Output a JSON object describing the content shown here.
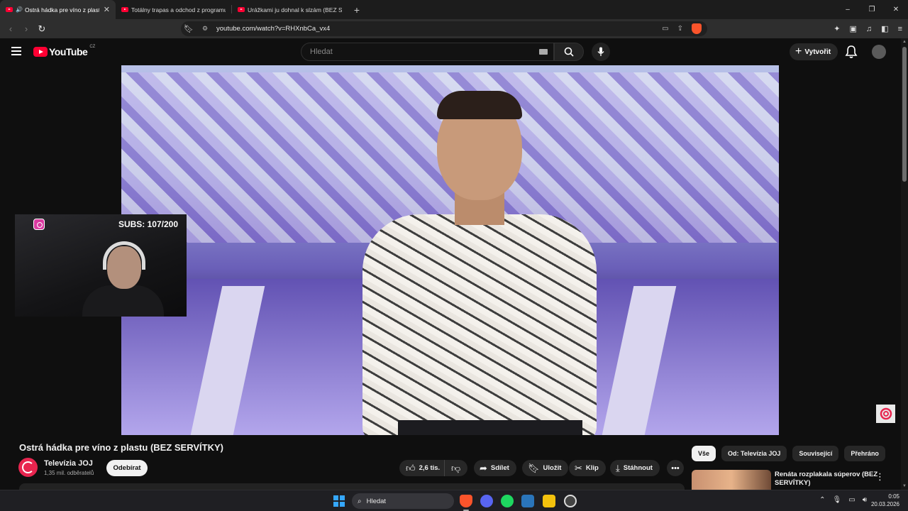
{
  "browser": {
    "tabs": [
      {
        "label": "Ostrá hádka pre víno z plastu",
        "active": true,
        "audio": true
      },
      {
        "label": "Totálny trapas a odchod z programu",
        "active": false
      },
      {
        "label": "Urážkami ju dohnal k slzám (BEZ SER",
        "active": false
      }
    ],
    "new_tab": "+",
    "window_controls": {
      "minimize": "–",
      "restore": "❐",
      "close": "✕"
    },
    "url": "youtube.com/watch?v=RHXnbCa_vx4"
  },
  "youtube": {
    "logo_text": "YouTube",
    "country_code": "CZ",
    "search_placeholder": "Hledat",
    "create_label": "Vytvořit"
  },
  "overlay": {
    "subs_counter": "SUBS: 107/200"
  },
  "video": {
    "title": "Ostrá hádka pre víno z plastu (BEZ SERVÍTKY)",
    "channel_name": "Televízia JOJ",
    "channel_subscribers": "1,35 mil. odběratelů",
    "subscribe_label": "Odebírat",
    "like_count": "2,6 tis.",
    "share_label": "Sdílet",
    "save_label": "Uložit",
    "clip_label": "Klip",
    "download_label": "Stáhnout"
  },
  "sidebar": {
    "chips": [
      "Vše",
      "Od: Televízia JOJ",
      "Související",
      "Přehráno"
    ],
    "selected_chip": "Vše",
    "recommendation_title": "Renáta rozplakala súperov (BEZ SERVÍTKY)"
  },
  "taskbar": {
    "search_label": "Hledat",
    "time": "0:05",
    "date": "20.03.2026"
  },
  "colors": {
    "youtube_red": "#ff0033",
    "background": "#0f0f0f",
    "chip_bg": "#272727",
    "joj_red": "#e8254f"
  }
}
